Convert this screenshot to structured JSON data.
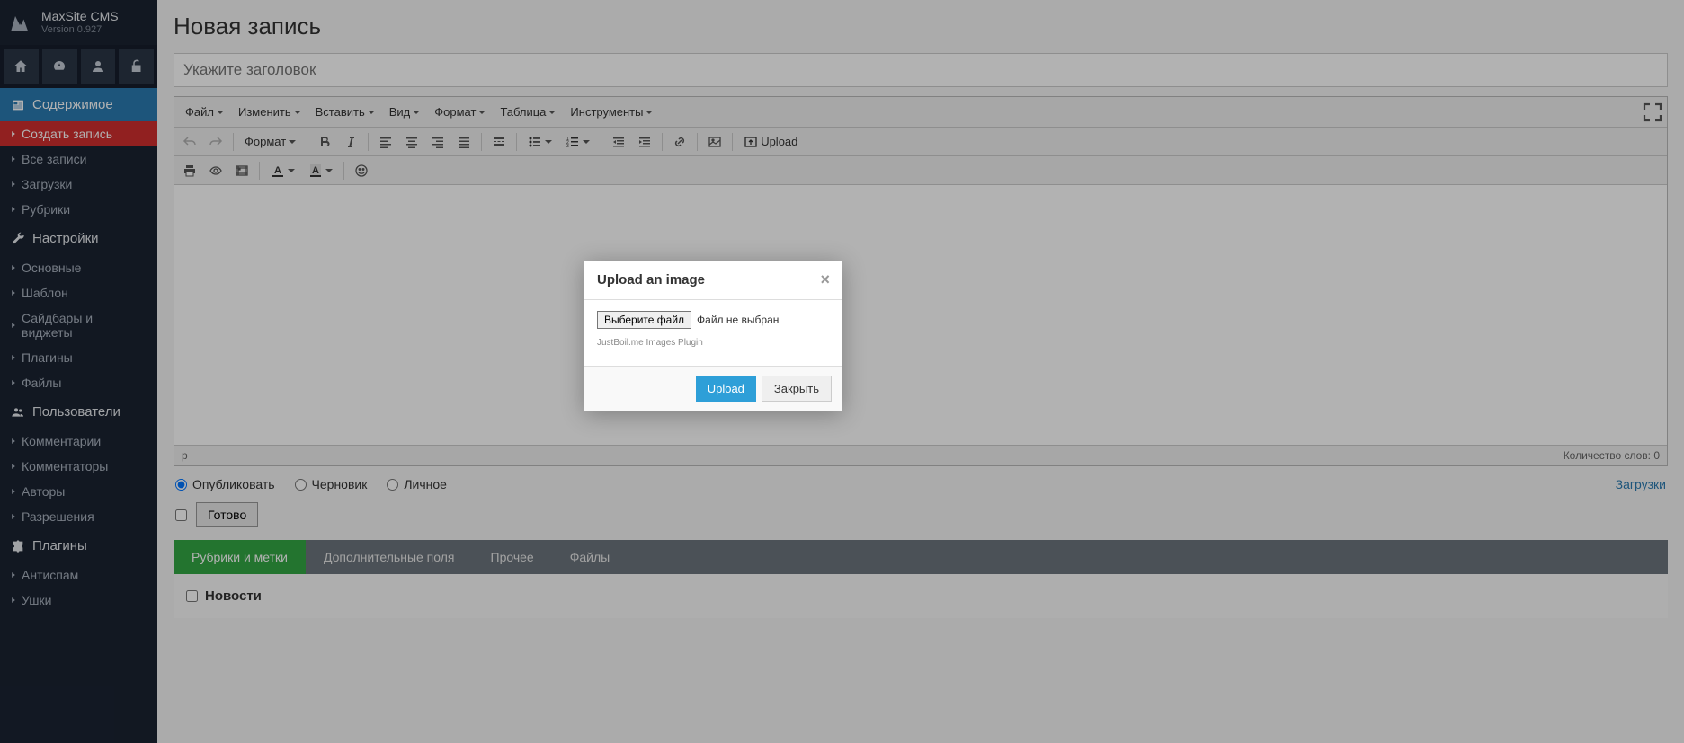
{
  "brand": {
    "title": "MaxSite CMS",
    "version": "Version 0.927"
  },
  "sidebar": {
    "sections": [
      {
        "title": "Содержимое",
        "items": [
          "Создать запись",
          "Все записи",
          "Загрузки",
          "Рубрики"
        ]
      },
      {
        "title": "Настройки",
        "items": [
          "Основные",
          "Шаблон",
          "Сайдбары и виджеты",
          "Плагины",
          "Файлы"
        ]
      },
      {
        "title": "Пользователи",
        "items": [
          "Комментарии",
          "Комментаторы",
          "Авторы",
          "Разрешения"
        ]
      },
      {
        "title": "Плагины",
        "items": [
          "Антиспам",
          "Ушки"
        ]
      }
    ]
  },
  "page": {
    "title": "Новая запись",
    "titlePlaceholder": "Укажите заголовок"
  },
  "menubar": [
    "Файл",
    "Изменить",
    "Вставить",
    "Вид",
    "Формат",
    "Таблица",
    "Инструменты"
  ],
  "toolbar": {
    "formatLabel": "Формат",
    "uploadLabel": "Upload"
  },
  "statusbar": {
    "path": "p",
    "words": "Количество слов: 0"
  },
  "publish": {
    "opts": [
      "Опубликовать",
      "Черновик",
      "Личное"
    ],
    "link": "Загрузки",
    "readyBtn": "Готово"
  },
  "tabs": [
    "Рубрики и метки",
    "Дополнительные поля",
    "Прочее",
    "Файлы"
  ],
  "categories": [
    "Новости"
  ],
  "modal": {
    "title": "Upload an image",
    "fileBtn": "Выберите файл",
    "fileStatus": "Файл не выбран",
    "plugin": "JustBoil.me Images Plugin",
    "upload": "Upload",
    "close": "Закрыть"
  }
}
